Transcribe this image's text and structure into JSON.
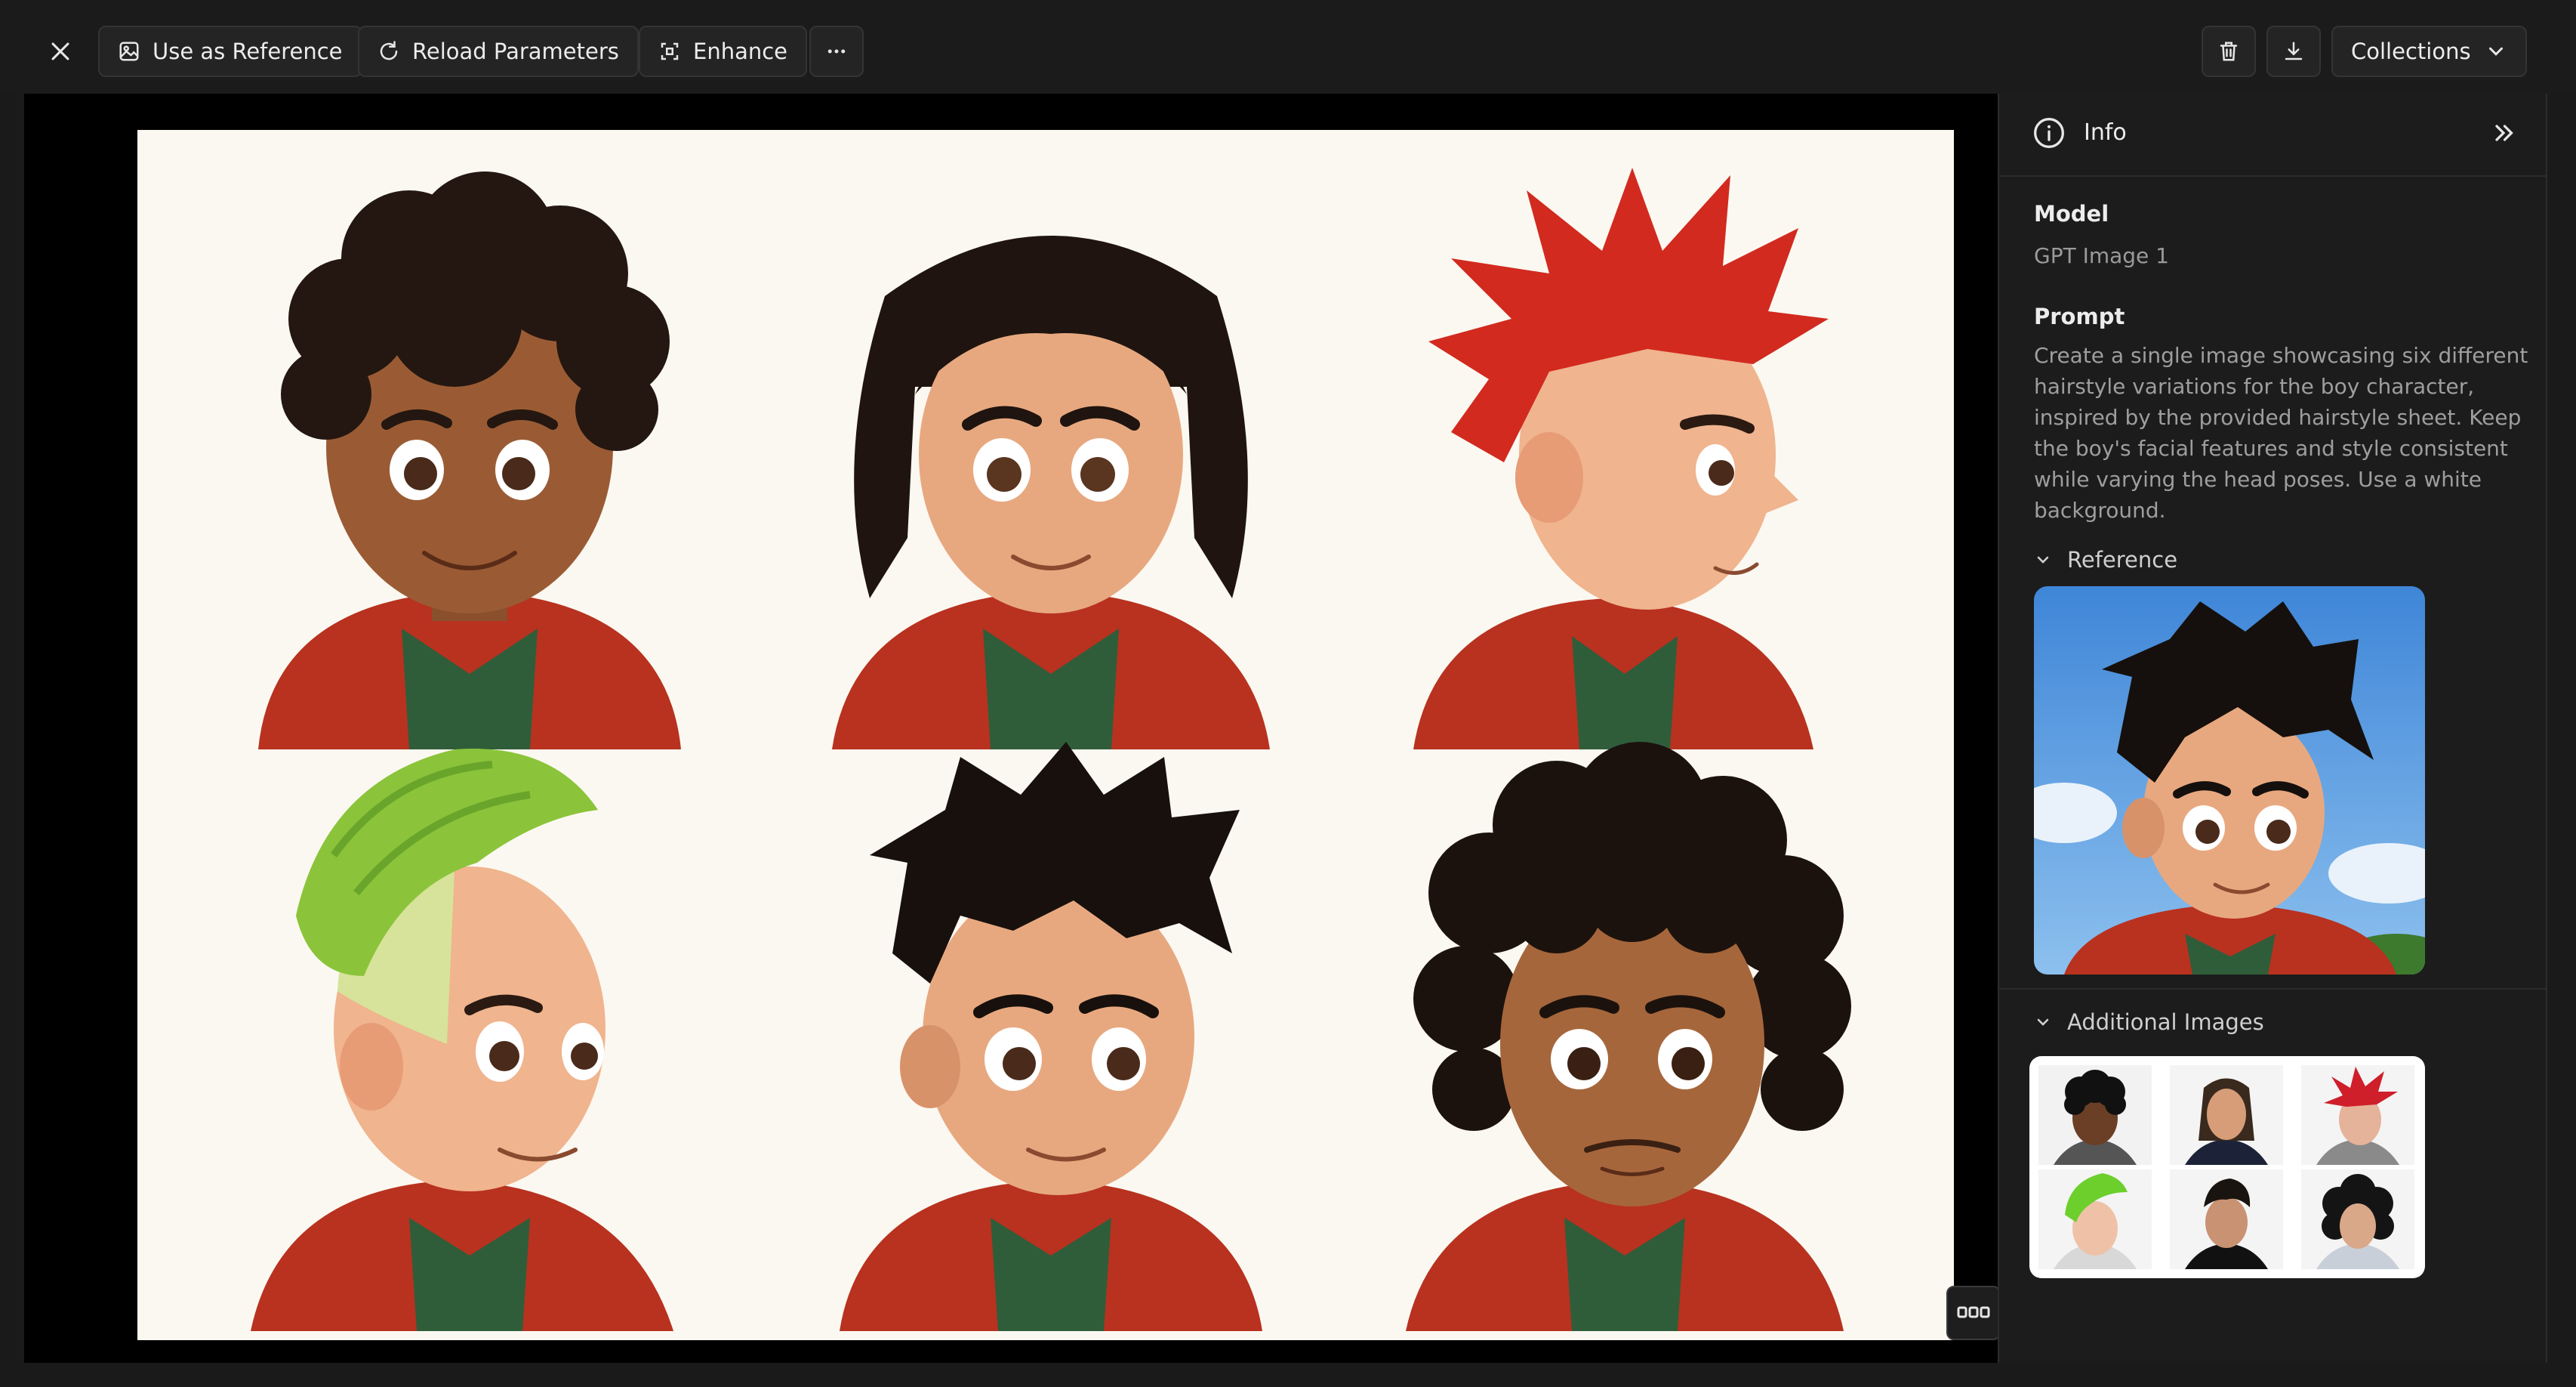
{
  "toolbar": {
    "use_reference_label": "Use as Reference",
    "reload_label": "Reload Parameters",
    "enhance_label": "Enhance",
    "collections_label": "Collections",
    "icons": [
      "close-icon",
      "image-icon",
      "refresh-icon",
      "enhance-icon",
      "more-icon",
      "trash-icon",
      "download-icon",
      "chevron-down-icon"
    ]
  },
  "canvas": {
    "background": "#fbf8f1",
    "portraits": [
      {
        "hair": "black curly afro",
        "hair_color": "#241711",
        "skin": "#9a5b34"
      },
      {
        "hair": "long wavy dark",
        "hair_color": "#1f140f",
        "skin": "#e8a87f"
      },
      {
        "hair": "red spiky",
        "hair_color": "#d22a1f",
        "skin": "#f0b48e"
      },
      {
        "hair": "green mohawk",
        "hair_color": "#8bc43a",
        "skin": "#f0b48e"
      },
      {
        "hair": "messy black",
        "hair_color": "#18100c",
        "skin": "#e8a87f"
      },
      {
        "hair": "curly black",
        "hair_color": "#1c120d",
        "skin": "#a6663b"
      }
    ]
  },
  "panel": {
    "header_title": "Info",
    "model_label": "Model",
    "model_value": "GPT Image 1",
    "prompt_label": "Prompt",
    "prompt_text": "Create a single image showcasing six different hairstyle variations for the boy character, inspired by the provided hairstyle sheet. Keep the boy's facial features and style consistent while varying the head poses. Use a white background.",
    "reference_label": "Reference",
    "additional_label": "Additional Images"
  },
  "colors": {
    "app_bg": "#1a1a1a",
    "button_bg": "#242424",
    "hoodie": "#b8321f",
    "shirt": "#2f5d3a"
  }
}
